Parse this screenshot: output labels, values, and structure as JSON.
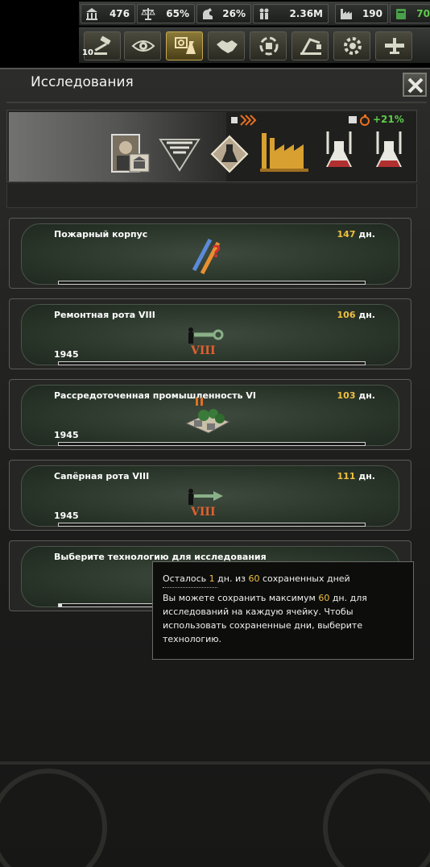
{
  "topbar": {
    "resources": [
      {
        "name": "political-power",
        "icon": "building-icon",
        "value": "476"
      },
      {
        "name": "stability",
        "icon": "scales-icon",
        "value": "65%"
      },
      {
        "name": "war-support",
        "icon": "arm-icon",
        "value": "26%"
      },
      {
        "name": "manpower",
        "icon": "soldiers-icon",
        "value": "2.36M"
      },
      {
        "name": "factories",
        "icon": "factory-icon",
        "value": "190"
      },
      {
        "name": "fuel",
        "icon": "fuel-icon",
        "value": "70"
      }
    ],
    "decisions_badge": "10",
    "map_buttons": [
      {
        "name": "decisions",
        "icon": "gavel-icon"
      },
      {
        "name": "diplomacy-view",
        "icon": "eye-icon"
      },
      {
        "name": "research",
        "icon": "research-icon",
        "active": true
      },
      {
        "name": "trade",
        "icon": "handshake-icon"
      },
      {
        "name": "production",
        "icon": "production-icon"
      },
      {
        "name": "logistics",
        "icon": "crane-icon"
      },
      {
        "name": "equipment",
        "icon": "gear-icon"
      },
      {
        "name": "air",
        "icon": "plane-icon"
      }
    ]
  },
  "panel": {
    "title": "Исследования",
    "bonus": "+21%"
  },
  "slots": [
    {
      "name": "Пожарный корпус",
      "days": "147",
      "days_unit": "дн.",
      "year": "",
      "progress": 0.0,
      "icon": "fire-corps-icon"
    },
    {
      "name": "Ремонтная рота VIII",
      "days": "106",
      "days_unit": "дн.",
      "year": "1945",
      "progress": 0.0,
      "icon": "maintenance-company-icon",
      "roman": "VIII"
    },
    {
      "name": "Рассредоточенная промышленность VI",
      "days": "103",
      "days_unit": "дн.",
      "year": "1945",
      "progress": 0.0,
      "icon": "dispersed-industry-icon"
    },
    {
      "name": "Сапёрная рота VIII",
      "days": "111",
      "days_unit": "дн.",
      "year": "1945",
      "progress": 0.0,
      "icon": "engineer-company-icon",
      "roman": "VIII"
    },
    {
      "name": "Выберите технологию для исследования",
      "days": "",
      "days_unit": "",
      "year": "",
      "progress": 0.01,
      "icon": ""
    }
  ],
  "tooltip": {
    "line1_pre": "Осталось ",
    "line1_days": "1",
    "line1_mid": " дн. из ",
    "line1_total": "60",
    "line1_post": " сохраненных дней",
    "line2_pre": "Вы можете сохранить максимум ",
    "line2_days": "60",
    "line2_post": " дн. для исследований на каждую ячейку. Чтобы использовать сохраненные дни, выберите технологию."
  },
  "colors": {
    "highlight": "#f0c040",
    "bonus_green": "#5ecb4a",
    "active_button": "#8a7a3a"
  }
}
